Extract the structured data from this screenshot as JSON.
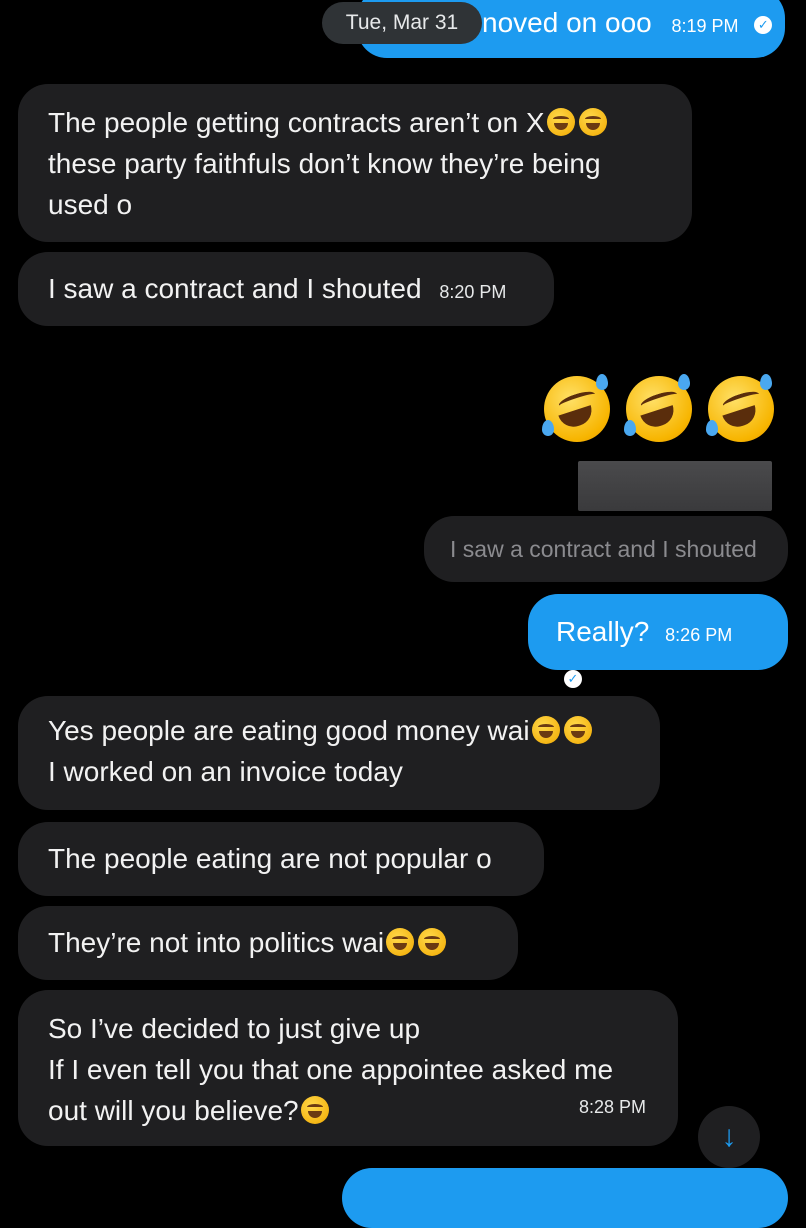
{
  "date_pill": "Tue, Mar 31",
  "top_partial": {
    "text": "noved on ooo",
    "time": "8:19 PM"
  },
  "messages": [
    {
      "lines": [
        "The people getting contracts aren’t on X",
        "these party faithfuls don’t know they’re being",
        "used o"
      ]
    },
    {
      "text": "I saw a contract and I shouted",
      "time": "8:20 PM"
    },
    {
      "reply_quote": "I saw a contract and I shouted"
    },
    {
      "text": "Really?",
      "time": "8:26 PM"
    },
    {
      "lines": [
        "Yes people are eating good money wai",
        "I worked on an invoice today"
      ]
    },
    {
      "text": "The people eating are not popular o"
    },
    {
      "text": "They’re not into politics wai"
    },
    {
      "lines": [
        "So I’ve decided to just give up",
        "If I even tell you that one appointee asked me",
        "out will you believe?"
      ],
      "time": "8:28 PM"
    }
  ],
  "icons": {
    "rofl": "rolling-on-floor-laughing-emoji",
    "tears_of_joy": "face-with-tears-of-joy-emoji",
    "read_receipt": "check-circle-icon",
    "scroll_down": "arrow-down-icon"
  },
  "colors": {
    "accent": "#1d9bf0",
    "incoming_bubble": "#1f1f21",
    "background": "#000000"
  }
}
